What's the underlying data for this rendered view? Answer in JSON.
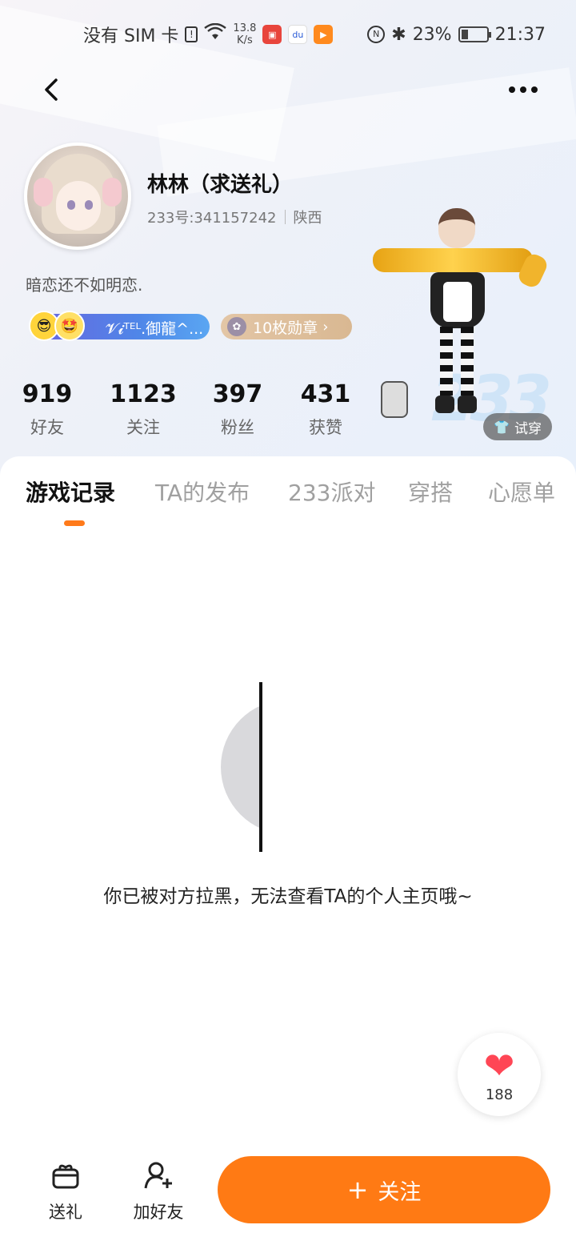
{
  "status_bar": {
    "carrier": "没有 SIM 卡",
    "net_speed_value": "13.8",
    "net_speed_unit": "K/s",
    "battery": "23%",
    "time": "21:37",
    "icons": [
      "sim-alert-icon",
      "wifi-icon",
      "huawei-store-icon",
      "baidu-icon",
      "video-app-icon",
      "nfc-icon",
      "bluetooth-icon",
      "battery-icon"
    ]
  },
  "profile": {
    "nickname": "林林（求送礼）",
    "uid": "233号:341157242",
    "location": "陕西",
    "signature": "暗恋还不如明恋.",
    "badge_text": "𝓥𝓲ᵀᴱᴸ.御龍^...",
    "medal_text": "10枚勋章"
  },
  "stats": [
    {
      "value": "919",
      "label": "好友"
    },
    {
      "value": "1123",
      "label": "关注"
    },
    {
      "value": "397",
      "label": "粉丝"
    },
    {
      "value": "431",
      "label": "获赞"
    }
  ],
  "try_on_label": "试穿",
  "tabs": [
    "游戏记录",
    "TA的发布",
    "233派对",
    "穿搭",
    "心愿单"
  ],
  "active_tab_index": 0,
  "empty_message": "你已被对方拉黑，无法查看TA的个人主页哦~",
  "like_count": "188",
  "bottom_bar": {
    "gift_label": "送礼",
    "add_friend_label": "加好友",
    "follow_label": "关注"
  },
  "colors": {
    "accent": "#ff7a14",
    "heart": "#ff4655",
    "badge_gradient_start": "#6a66e0",
    "medal_pill": "#d9b892"
  }
}
